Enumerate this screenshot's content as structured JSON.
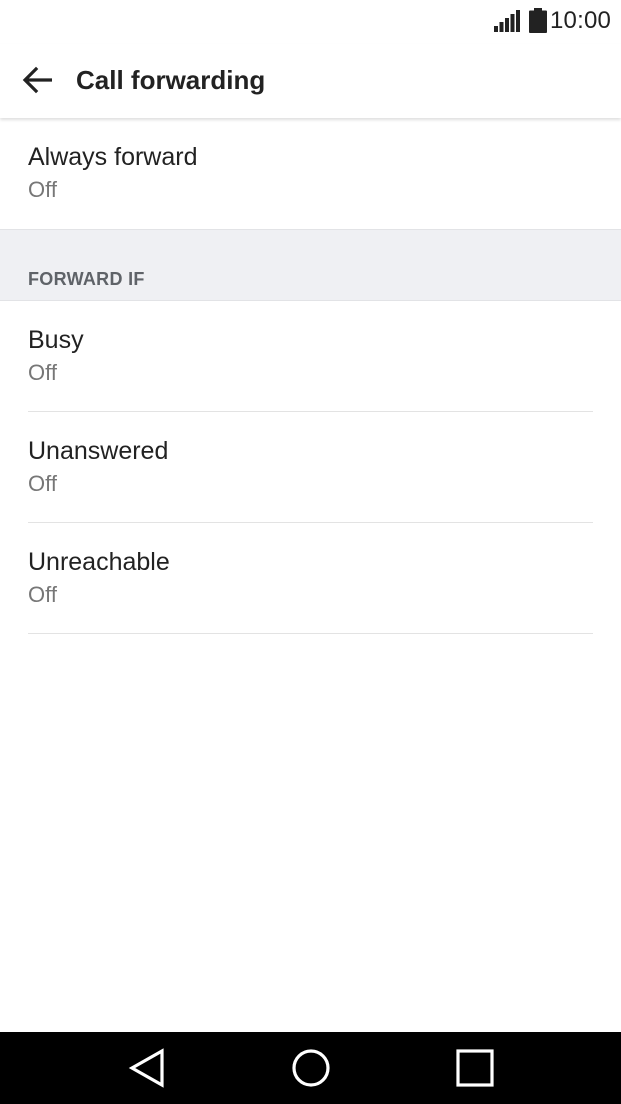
{
  "status_bar": {
    "time": "10:00",
    "signal_icon": "signal-bars-icon",
    "battery_icon": "battery-full-icon"
  },
  "app_bar": {
    "back_icon": "arrow-back-icon",
    "title": "Call forwarding"
  },
  "always_forward": {
    "title": "Always forward",
    "summary": "Off"
  },
  "section": {
    "header": "FORWARD IF",
    "items": [
      {
        "title": "Busy",
        "summary": "Off"
      },
      {
        "title": "Unanswered",
        "summary": "Off"
      },
      {
        "title": "Unreachable",
        "summary": "Off"
      }
    ]
  },
  "nav_bar": {
    "back_icon": "triangle-back-icon",
    "home_icon": "circle-home-icon",
    "recents_icon": "square-recents-icon"
  },
  "colors": {
    "background": "#ffffff",
    "section_header_bg": "#eff0f3",
    "primary_text": "#222222",
    "secondary_text": "#777777",
    "nav_bar": "#000000"
  }
}
